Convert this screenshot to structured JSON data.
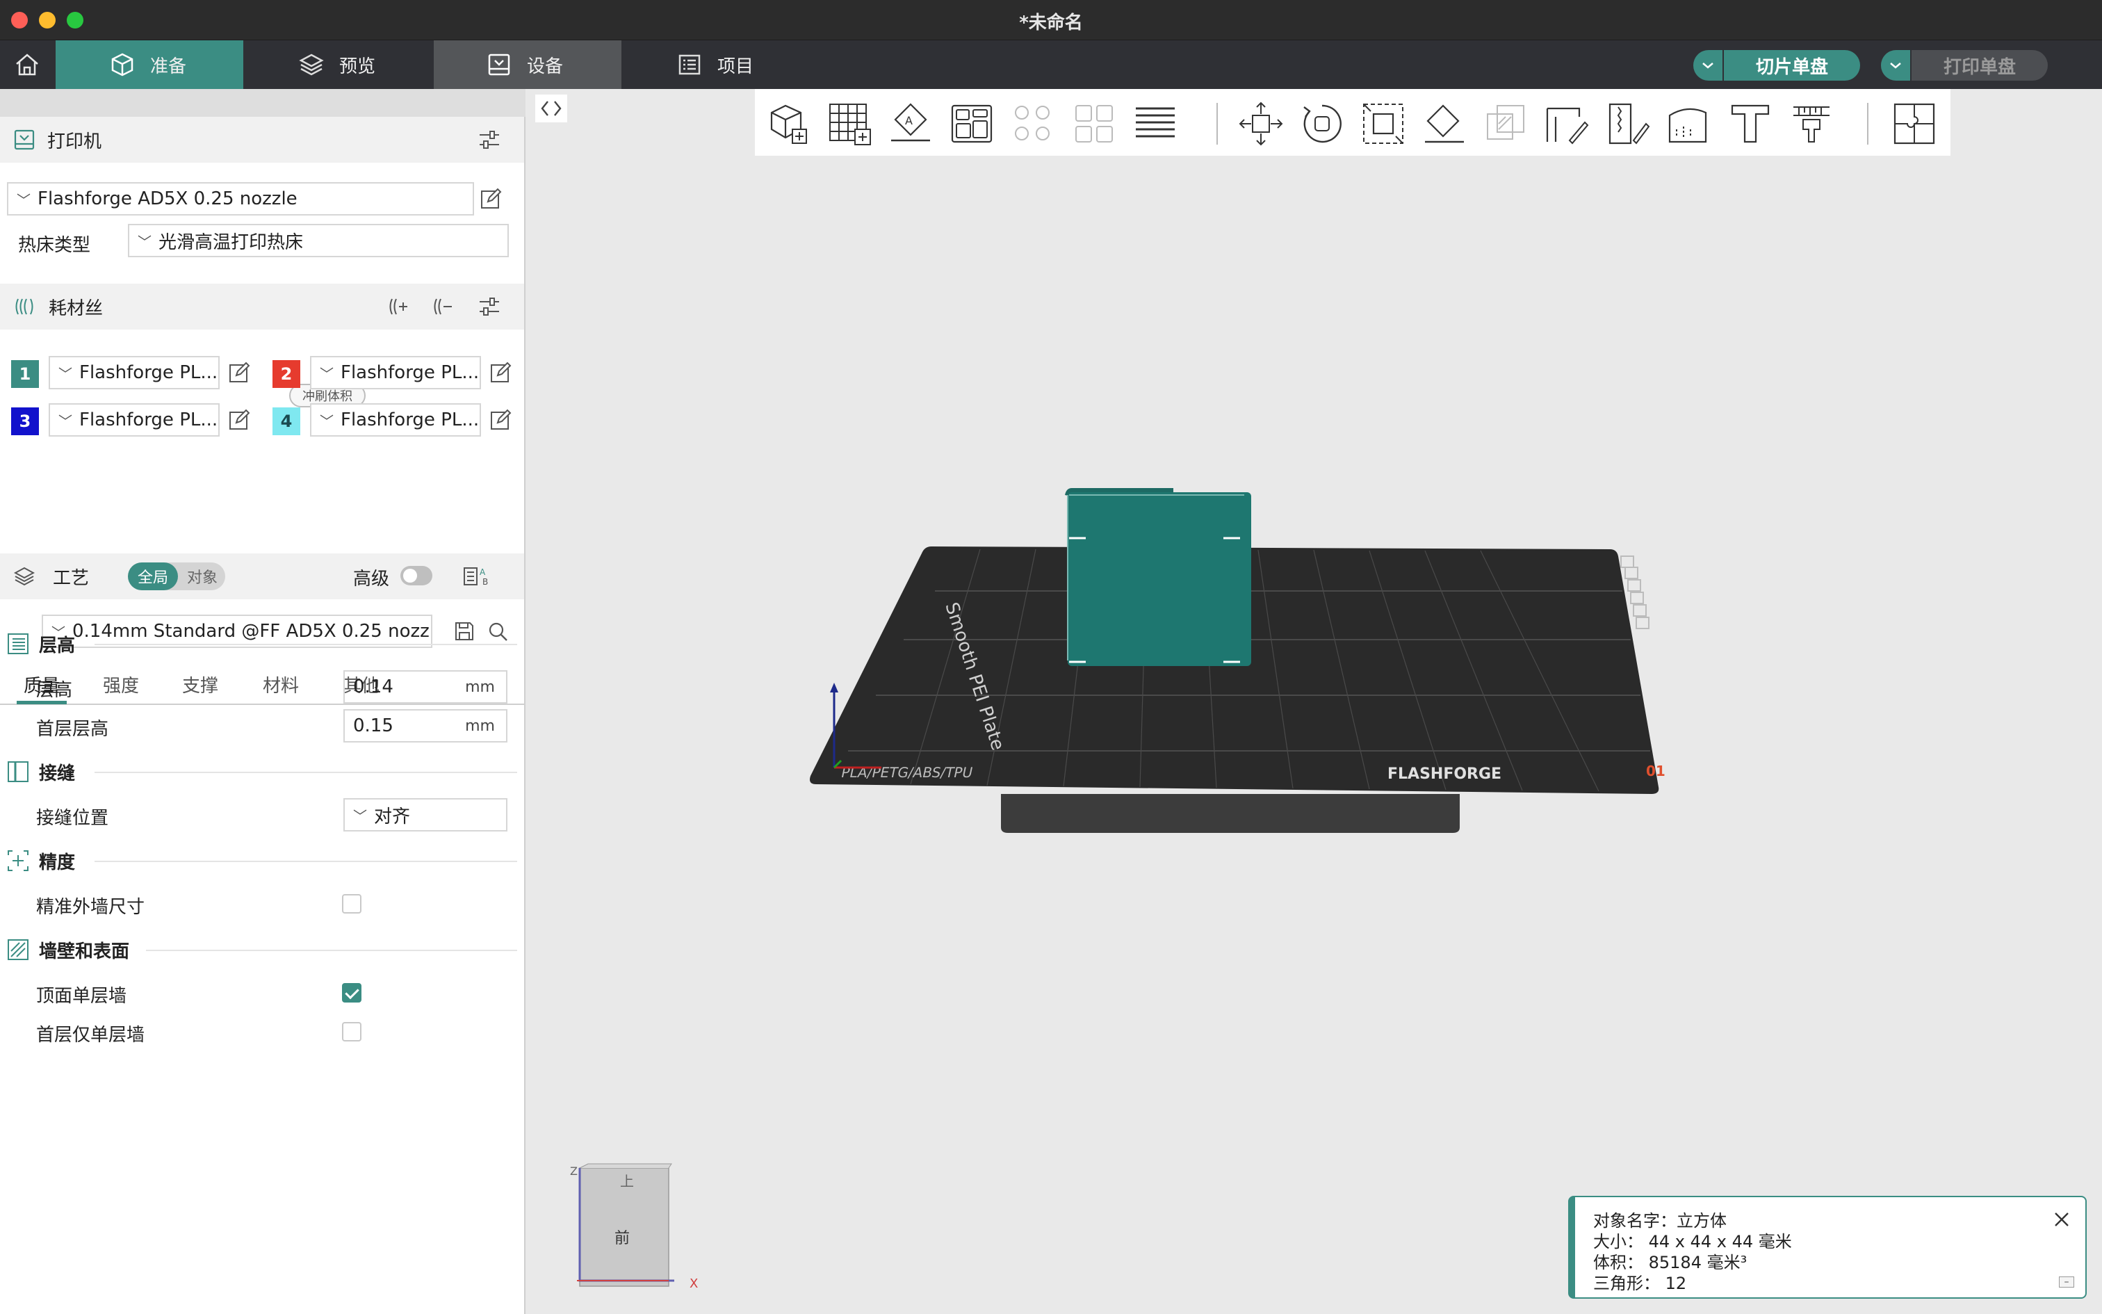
{
  "window": {
    "title": "*未命名"
  },
  "tabs": {
    "prepare": "准备",
    "preview": "预览",
    "device": "设备",
    "project": "项目"
  },
  "actions": {
    "slice": "切片单盘",
    "print": "打印单盘"
  },
  "printer": {
    "section_title": "打印机",
    "preset": "Flashforge AD5X 0.25 nozzle",
    "bed_label": "热床类型",
    "bed_value": "光滑高温打印热床"
  },
  "filament": {
    "section_title": "耗材丝",
    "flush_button": "冲刷体积",
    "slots": [
      {
        "num": "1",
        "name": "Flashforge PL...",
        "color": "#3b8d83"
      },
      {
        "num": "2",
        "name": "Flashforge PL...",
        "color": "#e63b2e"
      },
      {
        "num": "3",
        "name": "Flashforge PL...",
        "color": "#1212cc"
      },
      {
        "num": "4",
        "name": "Flashforge PL...",
        "color": "#7fe8f0"
      }
    ]
  },
  "process": {
    "section_title": "工艺",
    "scope_global": "全局",
    "scope_object": "对象",
    "advanced_label": "高级",
    "preset": "0.14mm Standard @FF AD5X 0.25 nozz...",
    "subtabs": [
      "质量",
      "强度",
      "支撑",
      "材料",
      "其他"
    ],
    "groups": {
      "layer_height": "层高",
      "seam": "接缝",
      "precision": "精度",
      "walls": "墙壁和表面"
    },
    "params": {
      "layer_height_label": "层高",
      "layer_height_value": "0.14",
      "first_layer_label": "首层层高",
      "first_layer_value": "0.15",
      "unit": "mm",
      "seam_position_label": "接缝位置",
      "seam_position_value": "对齐",
      "precise_wall_label": "精准外墙尺寸",
      "top_single_wall_label": "顶面单层墙",
      "first_single_wall_label": "首层仅单层墙"
    },
    "checks": {
      "precise_wall": false,
      "top_single_wall": true,
      "first_single_wall": false
    }
  },
  "viewport": {
    "plate_texts": {
      "name": "Smooth PEI Plate",
      "materials": "PLA/PETG/ABS/TPU",
      "brand": "FLASHFORGE",
      "plate_number": "01"
    },
    "view_cube": {
      "face": "前",
      "top": "上",
      "axis_x": "X",
      "axis_z": "Z"
    }
  },
  "object_info": {
    "name_line": "对象名字：立方体",
    "size_line": "大小：  44 x 44 x 44 毫米",
    "volume_line": "体积：  85184 毫米³",
    "triangles_line": "三角形：  12"
  },
  "colors": {
    "accent": "#3b8d83",
    "titlebar": "#2c2c2c",
    "tabbar": "#2f3035",
    "model": "#1e7770"
  }
}
